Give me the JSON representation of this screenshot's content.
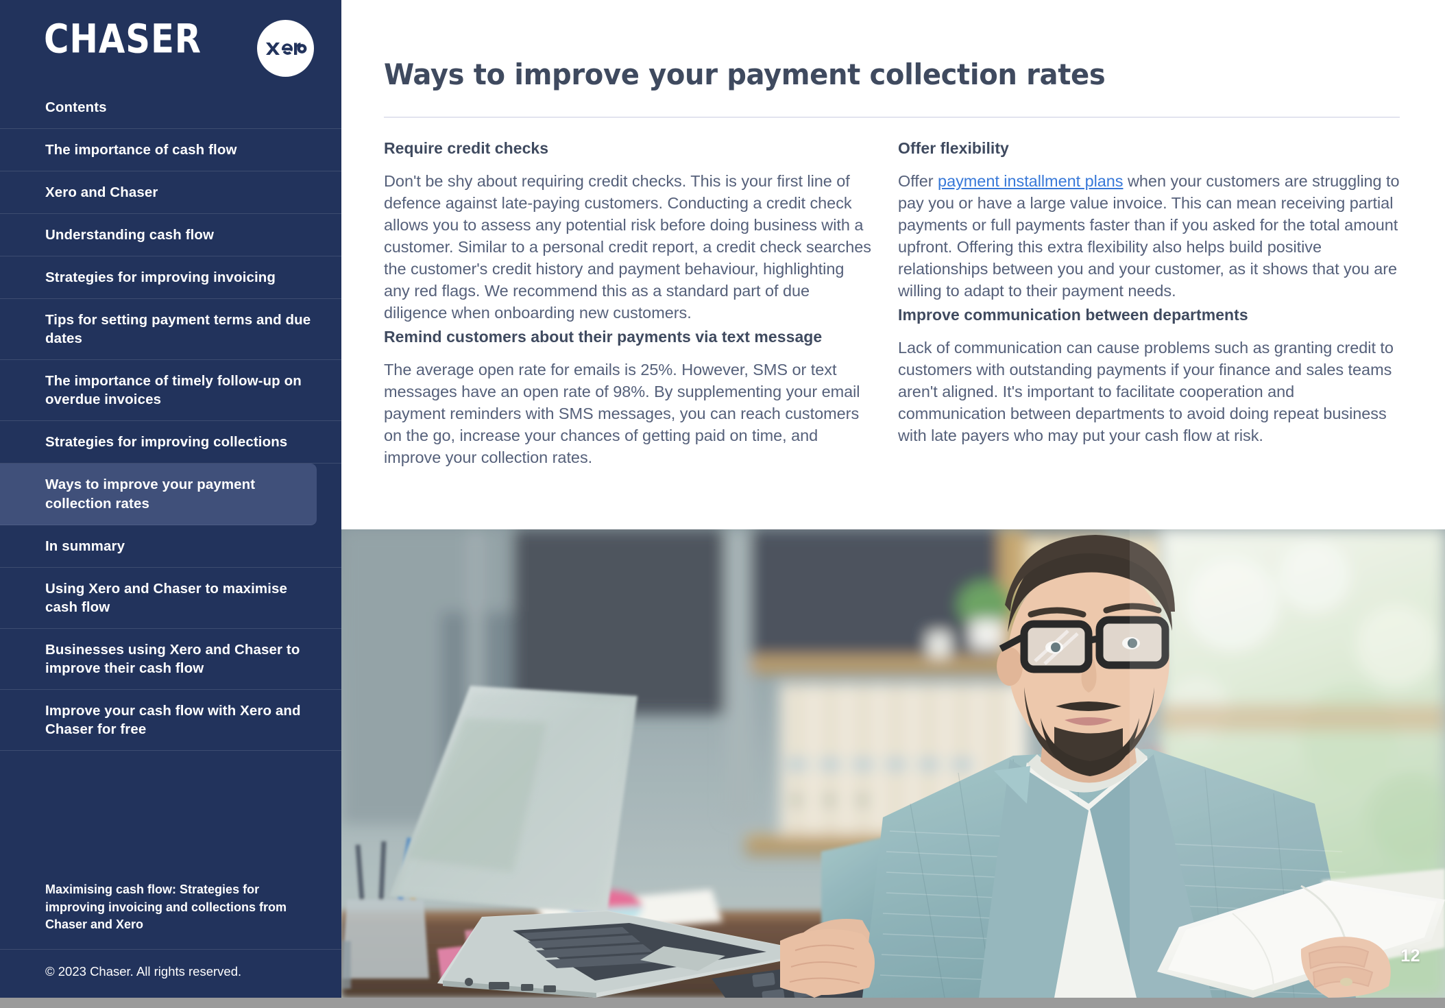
{
  "sidebar": {
    "brand": "CHASER",
    "partner_logo": "xero",
    "toc_items": [
      {
        "label": "Contents",
        "active": false
      },
      {
        "label": "The importance of cash flow",
        "active": false
      },
      {
        "label": "Xero and Chaser",
        "active": false
      },
      {
        "label": "Understanding cash flow",
        "active": false
      },
      {
        "label": "Strategies for improving invoicing",
        "active": false
      },
      {
        "label": "Tips for setting payment terms and due dates",
        "active": false
      },
      {
        "label": "The importance of timely follow-up on overdue invoices",
        "active": false
      },
      {
        "label": "Strategies for improving collections",
        "active": false
      },
      {
        "label": "Ways to improve your payment collection rates",
        "active": true
      },
      {
        "label": "In summary",
        "active": false
      },
      {
        "label": "Using Xero and Chaser to maximise cash flow",
        "active": false
      },
      {
        "label": "Businesses using Xero and Chaser to improve their cash flow",
        "active": false
      },
      {
        "label": "Improve your cash flow with Xero and Chaser for free",
        "active": false
      }
    ],
    "doc_subtitle": "Maximising cash flow: Strategies for improving invoicing and collections from Chaser and Xero",
    "copyright": "© 2023 Chaser. All rights reserved."
  },
  "main": {
    "title": "Ways to improve your payment collection rates",
    "left_column": [
      {
        "heading": "Require credit checks",
        "body": "Don't be shy about requiring credit checks. This is your first line of defence against late-paying customers. Conducting a credit check allows you to assess any potential risk before doing business with a customer. Similar to a personal credit report, a credit check searches the customer's credit history and payment behaviour, highlighting any red flags. We recommend this as a standard part of due diligence when onboarding new customers."
      },
      {
        "heading": "Remind customers about their payments via text message",
        "body": "The average open rate for emails is 25%. However, SMS or text messages have an open rate of 98%. By supplementing your email payment reminders with SMS messages, you can reach customers on the go, increase your chances of getting paid on time, and improve your collection rates."
      }
    ],
    "right_column": [
      {
        "heading": "Offer flexibility",
        "body_before_link": "Offer ",
        "link_text": "payment installment plans",
        "body_after_link": " when your customers are struggling to pay you or have a large value invoice. This can mean receiving partial payments or full payments faster than if you asked for the total amount upfront. Offering this extra flexibility also helps build positive relationships between you and your customer, as it shows that you are willing to adapt to their payment needs."
      },
      {
        "heading": "Improve communication between departments",
        "body": "Lack of communication can cause problems such as granting credit to customers with outstanding payments if your finance and sales teams aren't aligned. It's important to facilitate cooperation and communication between departments to avoid doing repeat business with late payers who may put your cash flow at risk."
      }
    ]
  },
  "photo": {
    "alt": "Bearded businessman in light blue blazer and glasses reading a paper document at a desk with a laptop and calculator in a bright office"
  },
  "page_number": "12",
  "colors": {
    "sidebar_bg": "#22335c",
    "sidebar_active": "#40507a",
    "heading_text": "#3f4a5f",
    "body_text": "#55607a",
    "link": "#3778d8",
    "rule": "#e2e3ee",
    "divider": "#3d4c70"
  }
}
